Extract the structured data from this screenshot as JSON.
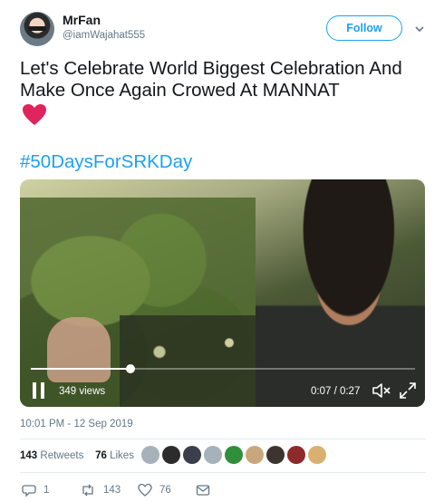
{
  "author": {
    "display_name": "MrFan",
    "handle": "@iamWajahat555",
    "follow_label": "Follow"
  },
  "tweet": {
    "text": "Let's Celebrate World Biggest Celebration And Make Once Again Crowed At MANNAT",
    "hashtag": "#50DaysForSRKDay",
    "timestamp": "10:01 PM - 12 Sep 2019"
  },
  "video": {
    "views": "349 views",
    "time": "0:07 / 0:27",
    "progress": 0.26
  },
  "stats": {
    "retweets_count": "143",
    "retweets_label": "Retweets",
    "likes_count": "76",
    "likes_label": "Likes"
  },
  "actions": {
    "reply_count": "1",
    "retweet_count": "143",
    "like_count": "76"
  },
  "colors": {
    "accent": "#1da1f2",
    "secondary_text": "#657786",
    "heart": "#e0245e"
  }
}
